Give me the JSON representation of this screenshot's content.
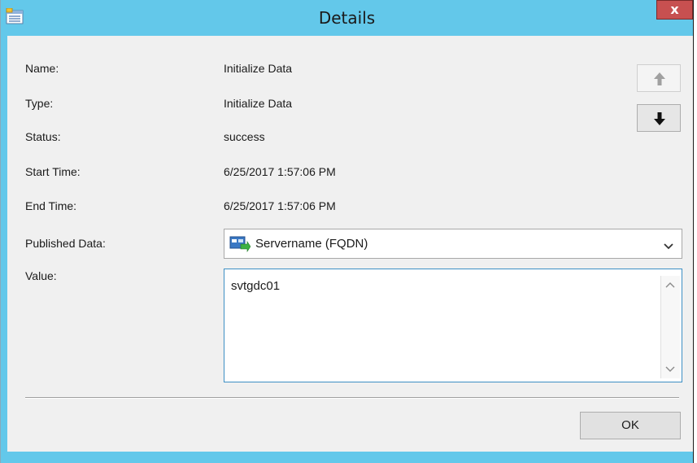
{
  "window": {
    "title": "Details",
    "close_label": "x",
    "colors": {
      "titlebar": "#63c8ea",
      "close": "#c75050",
      "client": "#f0f0f0"
    }
  },
  "fields": [
    {
      "label": "Name:",
      "value": "Initialize Data"
    },
    {
      "label": "Type:",
      "value": "Initialize Data"
    },
    {
      "label": "Status:",
      "value": "success"
    },
    {
      "label": "Start Time:",
      "value": "6/25/2017 1:57:06 PM"
    },
    {
      "label": "End Time:",
      "value": "6/25/2017 1:57:06 PM"
    }
  ],
  "nav": {
    "up_icon": "arrow-up-icon",
    "down_icon": "arrow-down-icon",
    "up_enabled": false,
    "down_enabled": true
  },
  "published_data": {
    "label": "Published Data:",
    "selected": "Servername (FQDN)",
    "icon": "data-field-icon"
  },
  "value_field": {
    "label": "Value:",
    "text": "svtgdc01"
  },
  "footer": {
    "ok_label": "OK"
  }
}
